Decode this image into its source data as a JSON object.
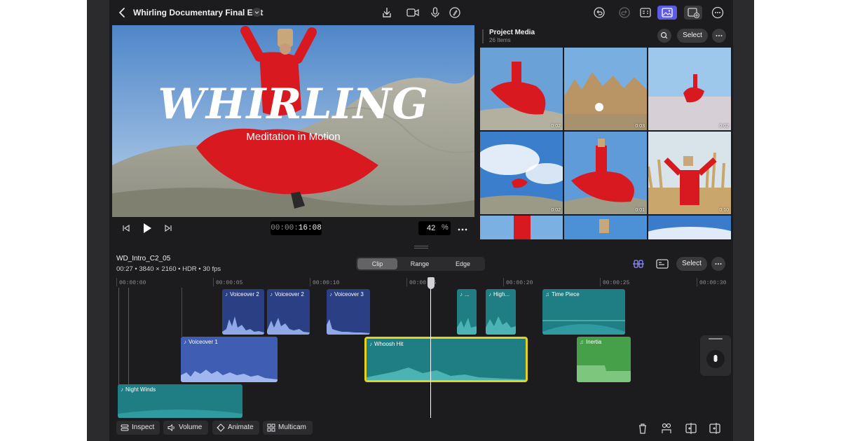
{
  "project": {
    "title": "Whirling Documentary Final Edit"
  },
  "viewer": {
    "title_text": "WHIRLING",
    "subtitle_text": "Meditation in Motion",
    "timecode_dim": "00:00:",
    "timecode_bright": "16:08",
    "zoom_value": "42",
    "zoom_unit": "%"
  },
  "media_browser": {
    "title": "Project Media",
    "count": "26 Items",
    "select_label": "Select",
    "durations": [
      "0:02",
      "0:03",
      "0:02",
      "0:02",
      "0:01",
      "0:10"
    ]
  },
  "clip_info": {
    "name": "WD_Intro_C2_05",
    "details": "00:27 • 3840 × 2160 • HDR • 30 fps"
  },
  "timeline_modes": [
    "Clip",
    "Range",
    "Edge"
  ],
  "timeline_select_label": "Select",
  "ruler": [
    "00:00:00",
    "00:00:05",
    "00:00:10",
    "00:00:15",
    "00:00:20",
    "00:00:25",
    "00:00:30"
  ],
  "clips": {
    "vo2a": "Voiceover 2",
    "vo2b": "Voiceover 2",
    "vo3": "Voiceover 3",
    "small": "...",
    "high": "High...",
    "timepiece": "Time Piece",
    "vo1": "Voiceover 1",
    "whoosh": "Whoosh Hit",
    "inertia": "Inertia",
    "night": "Night Winds"
  },
  "bottom_buttons": {
    "inspect": "Inspect",
    "volume": "Volume",
    "animate": "Animate",
    "multicam": "Multicam"
  },
  "colors": {
    "accent": "#5e5ce6",
    "clip_blue": "#3f5db3",
    "clip_teal": "#1e7e84",
    "clip_green": "#46a049",
    "selection_yellow": "#e7d21a"
  }
}
